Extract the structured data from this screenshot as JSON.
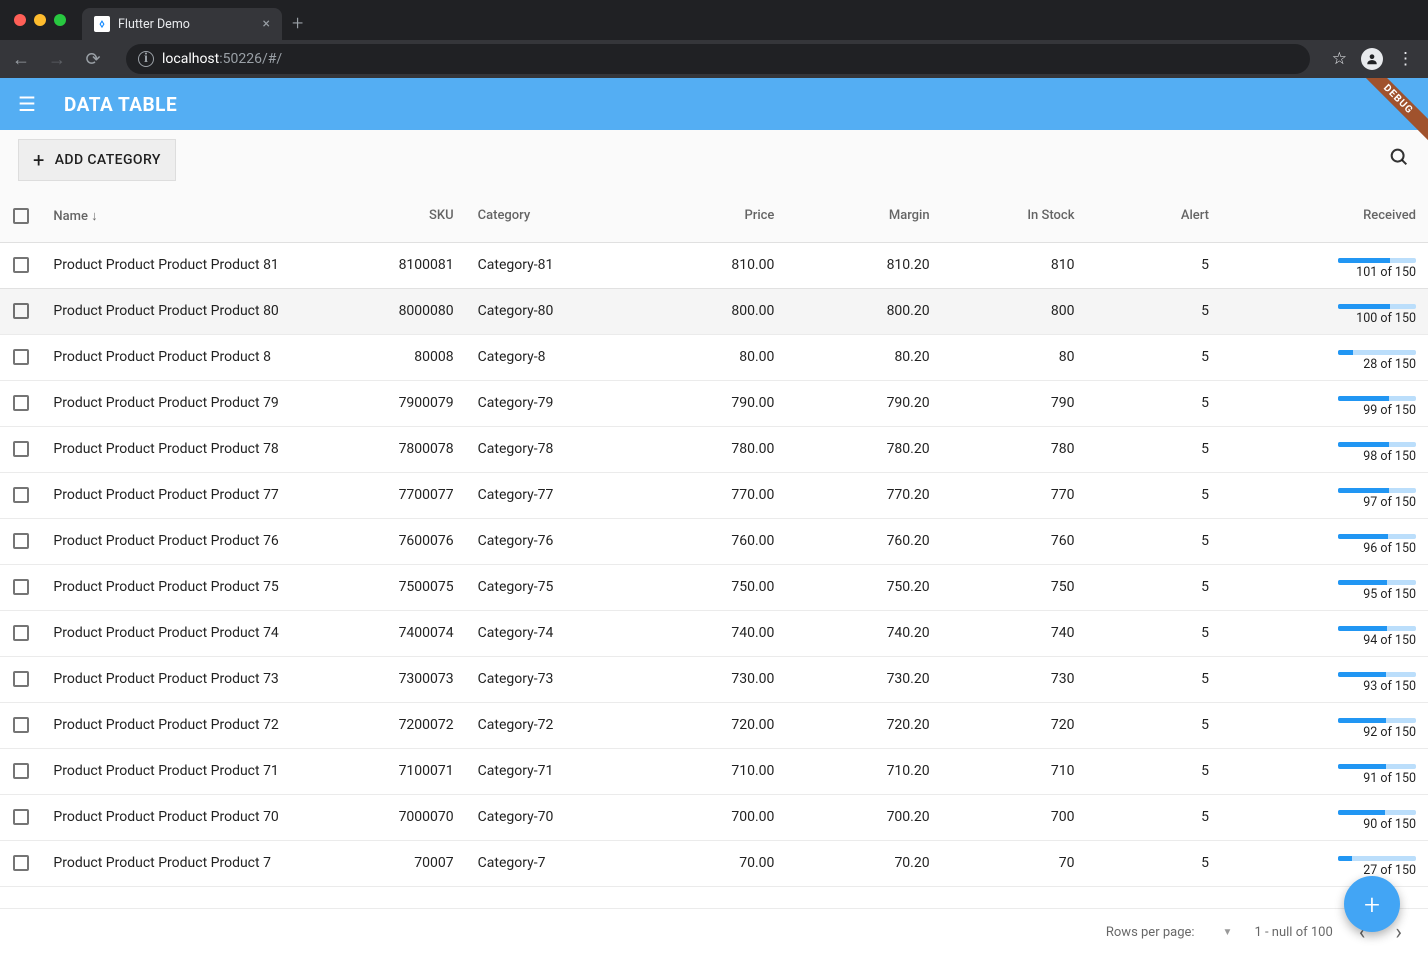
{
  "browser": {
    "tab_title": "Flutter Demo",
    "url_host": "localhost",
    "url_rest": ":50226/#/"
  },
  "appbar": {
    "title": "DATA TABLE",
    "debug_label": "DEBUG"
  },
  "toolbar": {
    "add_category_label": "ADD CATEGORY"
  },
  "columns": {
    "name": "Name",
    "sku": "SKU",
    "category": "Category",
    "price": "Price",
    "margin": "Margin",
    "in_stock": "In Stock",
    "alert": "Alert",
    "received": "Received"
  },
  "sort_arrow": "↓",
  "rows": [
    {
      "name": "Product Product Product Product 81",
      "sku": "8100081",
      "category": "Category-81",
      "price": "810.00",
      "margin": "810.20",
      "stock": "810",
      "alert": "5",
      "recv_num": 101,
      "recv_den": 150,
      "cut": true
    },
    {
      "name": "Product Product Product Product 80",
      "sku": "8000080",
      "category": "Category-80",
      "price": "800.00",
      "margin": "800.20",
      "stock": "800",
      "alert": "5",
      "recv_num": 100,
      "recv_den": 150,
      "hover": true
    },
    {
      "name": "Product Product Product Product 8",
      "sku": "80008",
      "category": "Category-8",
      "price": "80.00",
      "margin": "80.20",
      "stock": "80",
      "alert": "5",
      "recv_num": 28,
      "recv_den": 150
    },
    {
      "name": "Product Product Product Product 79",
      "sku": "7900079",
      "category": "Category-79",
      "price": "790.00",
      "margin": "790.20",
      "stock": "790",
      "alert": "5",
      "recv_num": 99,
      "recv_den": 150
    },
    {
      "name": "Product Product Product Product 78",
      "sku": "7800078",
      "category": "Category-78",
      "price": "780.00",
      "margin": "780.20",
      "stock": "780",
      "alert": "5",
      "recv_num": 98,
      "recv_den": 150
    },
    {
      "name": "Product Product Product Product 77",
      "sku": "7700077",
      "category": "Category-77",
      "price": "770.00",
      "margin": "770.20",
      "stock": "770",
      "alert": "5",
      "recv_num": 97,
      "recv_den": 150
    },
    {
      "name": "Product Product Product Product 76",
      "sku": "7600076",
      "category": "Category-76",
      "price": "760.00",
      "margin": "760.20",
      "stock": "760",
      "alert": "5",
      "recv_num": 96,
      "recv_den": 150
    },
    {
      "name": "Product Product Product Product 75",
      "sku": "7500075",
      "category": "Category-75",
      "price": "750.00",
      "margin": "750.20",
      "stock": "750",
      "alert": "5",
      "recv_num": 95,
      "recv_den": 150
    },
    {
      "name": "Product Product Product Product 74",
      "sku": "7400074",
      "category": "Category-74",
      "price": "740.00",
      "margin": "740.20",
      "stock": "740",
      "alert": "5",
      "recv_num": 94,
      "recv_den": 150
    },
    {
      "name": "Product Product Product Product 73",
      "sku": "7300073",
      "category": "Category-73",
      "price": "730.00",
      "margin": "730.20",
      "stock": "730",
      "alert": "5",
      "recv_num": 93,
      "recv_den": 150
    },
    {
      "name": "Product Product Product Product 72",
      "sku": "7200072",
      "category": "Category-72",
      "price": "720.00",
      "margin": "720.20",
      "stock": "720",
      "alert": "5",
      "recv_num": 92,
      "recv_den": 150
    },
    {
      "name": "Product Product Product Product 71",
      "sku": "7100071",
      "category": "Category-71",
      "price": "710.00",
      "margin": "710.20",
      "stock": "710",
      "alert": "5",
      "recv_num": 91,
      "recv_den": 150
    },
    {
      "name": "Product Product Product Product 70",
      "sku": "7000070",
      "category": "Category-70",
      "price": "700.00",
      "margin": "700.20",
      "stock": "700",
      "alert": "5",
      "recv_num": 90,
      "recv_den": 150
    },
    {
      "name": "Product Product Product Product 7",
      "sku": "70007",
      "category": "Category-7",
      "price": "70.00",
      "margin": "70.20",
      "stock": "70",
      "alert": "5",
      "recv_num": 27,
      "recv_den": 150
    }
  ],
  "recv_of_word": "of",
  "pager": {
    "rows_per_page_label": "Rows per page:",
    "range_text": "1 - null of 100"
  }
}
